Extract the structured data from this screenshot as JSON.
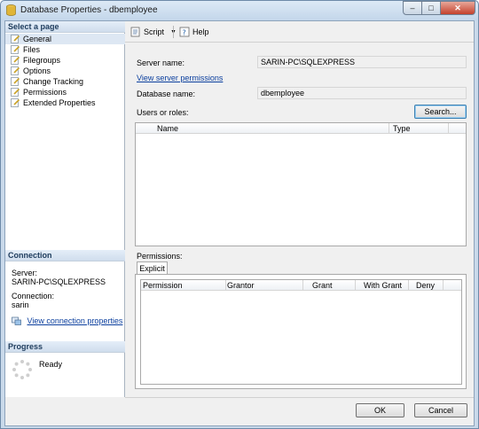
{
  "window": {
    "title": "Database Properties - dbemployee",
    "controls": {
      "minimize": "–",
      "maximize": "□",
      "close": "✕"
    }
  },
  "left": {
    "select_page_header": "Select a page",
    "pages": [
      {
        "label": "General",
        "selected": true
      },
      {
        "label": "Files"
      },
      {
        "label": "Filegroups"
      },
      {
        "label": "Options"
      },
      {
        "label": "Change Tracking"
      },
      {
        "label": "Permissions"
      },
      {
        "label": "Extended Properties"
      }
    ],
    "connection_header": "Connection",
    "server_label": "Server:",
    "server_value": "SARIN-PC\\SQLEXPRESS",
    "connection_label": "Connection:",
    "connection_value": "sarin",
    "view_connection_link": "View connection properties",
    "progress_header": "Progress",
    "progress_status": "Ready"
  },
  "toolbar": {
    "script_label": "Script",
    "help_label": "Help"
  },
  "form": {
    "server_name_label": "Server name:",
    "server_name_value": "SARIN-PC\\SQLEXPRESS",
    "view_server_permissions": "View server permissions",
    "database_name_label": "Database name:",
    "database_name_value": "dbemployee",
    "users_or_roles_label": "Users or roles:",
    "search_button": "Search...",
    "users_columns": [
      "Name",
      "Type"
    ],
    "permissions_label": "Permissions:",
    "tab_explicit": "Explicit",
    "permissions_columns": [
      "Permission",
      "Grantor",
      "Grant",
      "With Grant",
      "Deny"
    ]
  },
  "buttons": {
    "ok": "OK",
    "cancel": "Cancel"
  },
  "colors": {
    "link": "#0b3f9e",
    "title_bar": "#c9d9ea",
    "close_button": "#c4412c"
  }
}
